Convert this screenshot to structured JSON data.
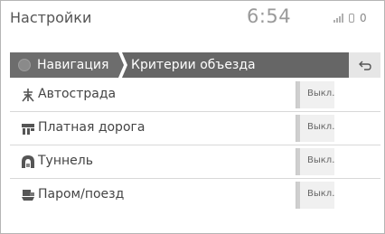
{
  "header": {
    "title": "Настройки",
    "clock": "6:54",
    "notification_count": "0"
  },
  "breadcrumb": {
    "home_label": "Навигация",
    "current_label": "Критерии объезда",
    "back_icon": "back-arrow-icon"
  },
  "options": [
    {
      "label": "Автострада",
      "icon": "highway-icon",
      "state": "Выкл."
    },
    {
      "label": "Платная дорога",
      "icon": "toll-road-icon",
      "state": "Выкл."
    },
    {
      "label": "Туннель",
      "icon": "tunnel-icon",
      "state": "Выкл."
    },
    {
      "label": "Паром/поезд",
      "icon": "ferry-train-icon",
      "state": "Выкл."
    }
  ],
  "colors": {
    "nav_bar": "#666666",
    "text": "#444444",
    "toggle_bg": "#f0f0f0"
  }
}
